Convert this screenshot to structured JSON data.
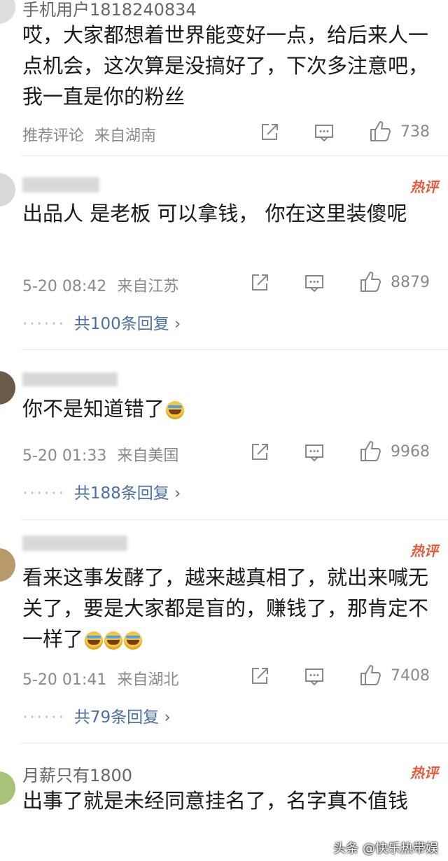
{
  "comments": [
    {
      "username": "手机用户1818240834",
      "text": "哎，大家都想着世界能变好一点，给后来人一点机会，这次算是没搞好了，下次多注意吧，我一直是你的粉丝",
      "time": "推荐评论",
      "location": "来自湖南",
      "likes": "738"
    },
    {
      "hot_label": "热评",
      "text": "出品人 是老板 可以拿钱， 你在这里装傻呢",
      "time": "5-20 08:42",
      "location": "来自江苏",
      "likes": "8879",
      "replies": "共100条回复 ›"
    },
    {
      "text": "你不是知道错了",
      "time": "5-20 01:33",
      "location": "来自美国",
      "likes": "9968",
      "replies": "共188条回复 ›"
    },
    {
      "hot_label": "热评",
      "text": "看来这事发酵了，越来越真相了，就出来喊无关了，要是大家都是盲的，赚钱了，那肯定不一样了",
      "time": "5-20 01:41",
      "location": "来自湖北",
      "likes": "7408",
      "replies": "共79条回复 ›"
    },
    {
      "username": "月薪只有1800",
      "hot_label": "热评",
      "text": "出事了就是未经同意挂名了，名字真不值钱"
    }
  ],
  "icons": {
    "share": "share-icon",
    "comment": "comment-icon",
    "like": "thumbs-up-icon",
    "reply_dots": "dots-icon"
  },
  "colors": {
    "hot": "#e8593a",
    "link": "#4a6fa5",
    "meta": "#8a8a8a"
  },
  "watermark": "头条 @快乐热带娱"
}
